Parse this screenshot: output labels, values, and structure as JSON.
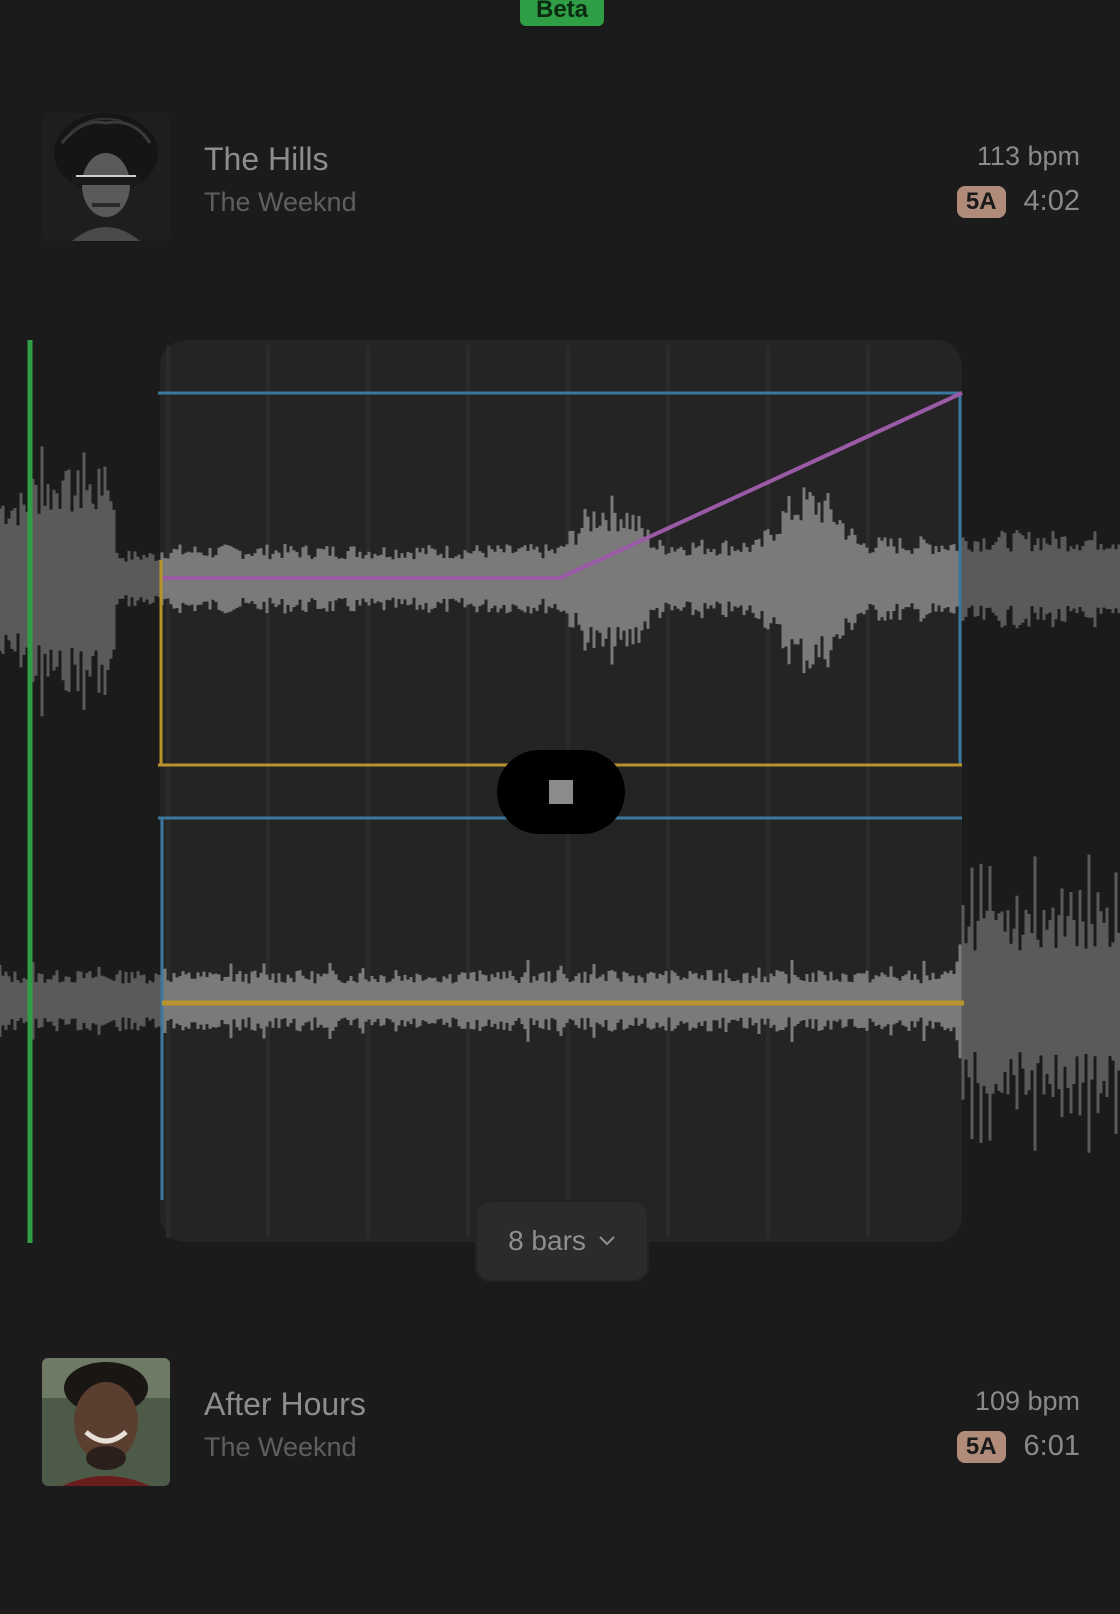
{
  "badge": {
    "label": "Beta"
  },
  "tracks": [
    {
      "title": "The Hills",
      "artist": "The Weeknd",
      "bpm": "113 bpm",
      "key": "5A",
      "duration": "4:02"
    },
    {
      "title": "After Hours",
      "artist": "The Weeknd",
      "bpm": "109 bpm",
      "key": "5A",
      "duration": "6:01"
    }
  ],
  "transition": {
    "bars_label": "8 bars"
  },
  "colors": {
    "accent_green": "#2f9e45",
    "key_badge": "#b08b7a",
    "line_blue": "#3b78a0",
    "line_yellow": "#b8922a",
    "line_purple": "#9b5aa6"
  }
}
